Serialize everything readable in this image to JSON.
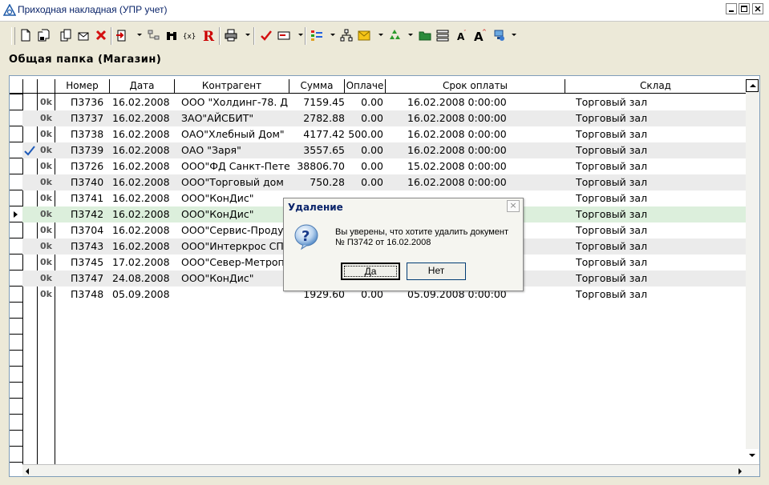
{
  "window": {
    "title": "Приходная накладная (УПР учет)"
  },
  "toolbar": {
    "buttons": [
      "new-document",
      "save",
      "copy",
      "edit",
      "delete",
      "import",
      "structure",
      "binoculars",
      "xml",
      "report-r",
      "print",
      "check",
      "mail",
      "colors",
      "tree",
      "envelope",
      "recycle",
      "folder",
      "layout",
      "font-decrease",
      "font-increase",
      "network"
    ]
  },
  "folder_label": "Общая папка (Магазин)",
  "table": {
    "headers": [
      "Номер",
      "Дата",
      "Контрагент",
      "Сумма",
      "Оплаче",
      "Срок оплаты",
      "Склад"
    ],
    "rows": [
      {
        "status": "0k",
        "number": "П3736",
        "date": "16.02.2008",
        "contractor": "ООО \"Холдинг-78. Д",
        "sum": "7159.45",
        "paid": "0.00",
        "due": "16.02.2008 0:00:00",
        "warehouse": "Торговый зал",
        "checked": false,
        "current": false
      },
      {
        "status": "0k",
        "number": "П3737",
        "date": "16.02.2008",
        "contractor": "ЗАО\"АЙСБИТ\"",
        "sum": "2782.88",
        "paid": "0.00",
        "due": "16.02.2008 0:00:00",
        "warehouse": "Торговый зал",
        "checked": false,
        "current": false
      },
      {
        "status": "0k",
        "number": "П3738",
        "date": "16.02.2008",
        "contractor": "ОАО\"Хлебный Дом\"",
        "sum": "4177.42",
        "paid": "500.00",
        "due": "16.02.2008 0:00:00",
        "warehouse": "Торговый зал",
        "checked": false,
        "current": false
      },
      {
        "status": "0k",
        "number": "П3739",
        "date": "16.02.2008",
        "contractor": "ОАО \"Заря\"",
        "sum": "3557.65",
        "paid": "0.00",
        "due": "16.02.2008 0:00:00",
        "warehouse": "Торговый зал",
        "checked": true,
        "current": false
      },
      {
        "status": "0k",
        "number": "П3726",
        "date": "16.02.2008",
        "contractor": "ООО\"ФД Санкт-Пете",
        "sum": "38806.70",
        "paid": "0.00",
        "due": "15.02.2008 0:00:00",
        "warehouse": "Торговый зал",
        "checked": false,
        "current": false
      },
      {
        "status": "0k",
        "number": "П3740",
        "date": "16.02.2008",
        "contractor": "ООО\"Торговый дом",
        "sum": "750.28",
        "paid": "0.00",
        "due": "16.02.2008 0:00:00",
        "warehouse": "Торговый зал",
        "checked": false,
        "current": false
      },
      {
        "status": "0k",
        "number": "П3741",
        "date": "16.02.2008",
        "contractor": "ООО\"КонДис\"",
        "sum": "",
        "paid": "",
        "due": "",
        "warehouse": "Торговый зал",
        "checked": false,
        "current": false
      },
      {
        "status": "0k",
        "number": "П3742",
        "date": "16.02.2008",
        "contractor": "ООО\"КонДис\"",
        "sum": "",
        "paid": "",
        "due": "",
        "warehouse": "Торговый зал",
        "checked": false,
        "current": true
      },
      {
        "status": "0k",
        "number": "П3704",
        "date": "16.02.2008",
        "contractor": "ООО\"Сервис-Проду",
        "sum": "",
        "paid": "",
        "due": "",
        "warehouse": "Торговый зал",
        "checked": false,
        "current": false
      },
      {
        "status": "0k",
        "number": "П3743",
        "date": "16.02.2008",
        "contractor": "ООО\"Интеркрос СП",
        "sum": "",
        "paid": "",
        "due": "",
        "warehouse": "Торговый зал",
        "checked": false,
        "current": false
      },
      {
        "status": "0k",
        "number": "П3745",
        "date": "17.02.2008",
        "contractor": "ООО\"Север-Метроп",
        "sum": "",
        "paid": "",
        "due": "",
        "warehouse": "Торговый зал",
        "checked": false,
        "current": false
      },
      {
        "status": "0k",
        "number": "П3747",
        "date": "24.08.2008",
        "contractor": "ООО\"КонДис\"",
        "sum": "",
        "paid": "",
        "due": "",
        "warehouse": "Торговый зал",
        "checked": false,
        "current": false
      },
      {
        "status": "0k",
        "number": "П3748",
        "date": "05.09.2008",
        "contractor": "",
        "sum": "1929.60",
        "paid": "0.00",
        "due": "05.09.2008 0:00:00",
        "warehouse": "Торговый зал",
        "checked": false,
        "current": false
      }
    ]
  },
  "dialog": {
    "title": "Удаление",
    "close": "×",
    "message_line1": "Вы уверены, что хотите удалить документ",
    "message_line2": "№ П3742 от 16.02.2008",
    "yes_label": "Да",
    "no_label": "Нет"
  },
  "colors": {
    "selected_row": "#dcefdc",
    "alt_row": "#ebebeb",
    "title_text": "#0a246a"
  }
}
